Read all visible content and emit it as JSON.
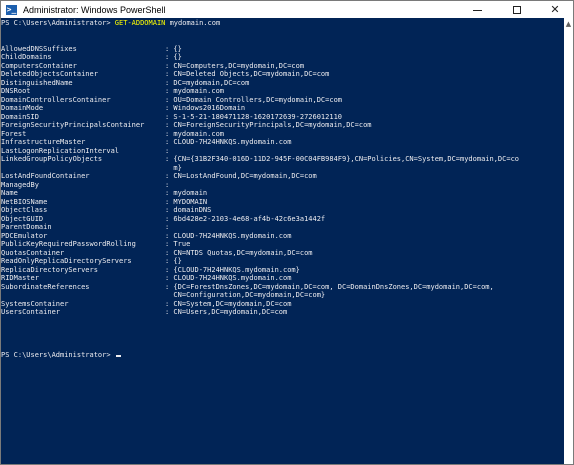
{
  "window": {
    "title": "Administrator: Windows PowerShell",
    "icon_glyph": ">_",
    "close_glyph": "✕"
  },
  "console": {
    "prompt": "PS C:\\Users\\Administrator> ",
    "command": "GET-ADDOMAIN",
    "argument": " mydomain.com",
    "properties": [
      {
        "name": "AllowedDNSSuffixes",
        "value": ": {}"
      },
      {
        "name": "ChildDomains",
        "value": ": {}"
      },
      {
        "name": "ComputersContainer",
        "value": ": CN=Computers,DC=mydomain,DC=com"
      },
      {
        "name": "DeletedObjectsContainer",
        "value": ": CN=Deleted Objects,DC=mydomain,DC=com"
      },
      {
        "name": "DistinguishedName",
        "value": ": DC=mydomain,DC=com"
      },
      {
        "name": "DNSRoot",
        "value": ": mydomain.com"
      },
      {
        "name": "DomainControllersContainer",
        "value": ": OU=Domain Controllers,DC=mydomain,DC=com"
      },
      {
        "name": "DomainMode",
        "value": ": Windows2016Domain"
      },
      {
        "name": "DomainSID",
        "value": ": S-1-5-21-180471128-1620172639-2726012110"
      },
      {
        "name": "ForeignSecurityPrincipalsContainer",
        "value": ": CN=ForeignSecurityPrincipals,DC=mydomain,DC=com"
      },
      {
        "name": "Forest",
        "value": ": mydomain.com"
      },
      {
        "name": "InfrastructureMaster",
        "value": ": CLOUD-7H24HNKQS.mydomain.com"
      },
      {
        "name": "LastLogonReplicationInterval",
        "value": ":"
      },
      {
        "name": "LinkedGroupPolicyObjects",
        "value": ": {CN={31B2F340-016D-11D2-945F-00C04FB984F9},CN=Policies,CN=System,DC=mydomain,DC=co",
        "cont": "  m}"
      },
      {
        "name": "LostAndFoundContainer",
        "value": ": CN=LostAndFound,DC=mydomain,DC=com"
      },
      {
        "name": "ManagedBy",
        "value": ":"
      },
      {
        "name": "Name",
        "value": ": mydomain"
      },
      {
        "name": "NetBIOSName",
        "value": ": MYDOMAIN"
      },
      {
        "name": "ObjectClass",
        "value": ": domainDNS"
      },
      {
        "name": "ObjectGUID",
        "value": ": 6bd428e2-2103-4e68-af4b-42c6e3a1442f"
      },
      {
        "name": "ParentDomain",
        "value": ":"
      },
      {
        "name": "PDCEmulator",
        "value": ": CLOUD-7H24HNKQS.mydomain.com"
      },
      {
        "name": "PublicKeyRequiredPasswordRolling",
        "value": ": True"
      },
      {
        "name": "QuotasContainer",
        "value": ": CN=NTDS Quotas,DC=mydomain,DC=com"
      },
      {
        "name": "ReadOnlyReplicaDirectoryServers",
        "value": ": {}"
      },
      {
        "name": "ReplicaDirectoryServers",
        "value": ": {CLOUD-7H24HNKQS.mydomain.com}"
      },
      {
        "name": "RIDMaster",
        "value": ": CLOUD-7H24HNKQS.mydomain.com"
      },
      {
        "name": "SubordinateReferences",
        "value": ": {DC=ForestDnsZones,DC=mydomain,DC=com, DC=DomainDnsZones,DC=mydomain,DC=com,",
        "cont": "  CN=Configuration,DC=mydomain,DC=com}"
      },
      {
        "name": "SystemsContainer",
        "value": ": CN=System,DC=mydomain,DC=com"
      },
      {
        "name": "UsersContainer",
        "value": ": CN=Users,DC=mydomain,DC=com"
      }
    ],
    "final_prompt": "PS C:\\Users\\Administrator> "
  },
  "colors": {
    "console_background": "#012456",
    "console_text": "#eeedf0",
    "command_text": "#ffff00"
  }
}
